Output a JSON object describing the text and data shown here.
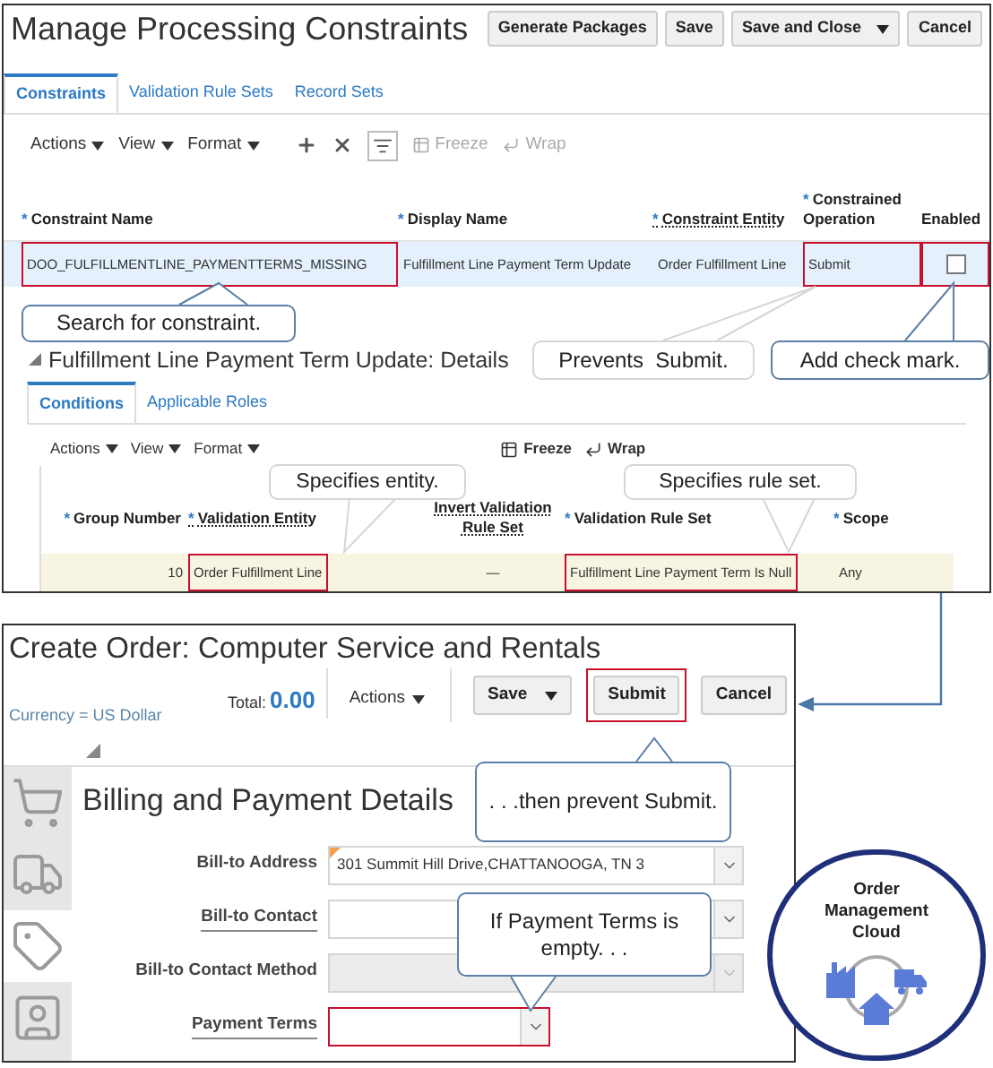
{
  "constraints": {
    "title": "Manage Processing Constraints",
    "buttons": [
      {
        "label": "Generate Packages",
        "kind": "button"
      },
      {
        "label": "Save",
        "kind": "button"
      },
      {
        "label": "Save and Close",
        "kind": "split"
      },
      {
        "label": "Cancel",
        "kind": "button"
      }
    ],
    "tabs": [
      {
        "label": "Constraints",
        "selected": true
      },
      {
        "label": "Validation Rule Sets",
        "selected": false
      },
      {
        "label": "Record Sets",
        "selected": false
      }
    ],
    "toolbar": {
      "menus": [
        "Actions",
        "View",
        "Format"
      ],
      "tools": [
        {
          "label": "Freeze",
          "disabled": true
        },
        {
          "label": "Wrap",
          "disabled": true
        }
      ]
    },
    "table": {
      "columns": [
        {
          "marker": "*",
          "label": "Constraint Name",
          "link": false
        },
        {
          "marker": "*",
          "label": "Display Name",
          "link": false
        },
        {
          "marker": "*",
          "label": "Constraint Entity",
          "link": true
        },
        {
          "marker": "*",
          "label": "Constrained Operation",
          "link": false
        },
        {
          "label": "Enabled",
          "link": false
        }
      ],
      "rows": [
        {
          "cells": [
            {
              "text": "DOO_FULFILLMENTLINE_PAYMENTTERMS_MISSING",
              "highlighted": true
            },
            {
              "text": "Fulfillment Line Payment Term Update",
              "highlighted": false
            },
            {
              "text": "Order Fulfillment Line",
              "highlighted": false
            },
            {
              "text": "Submit",
              "highlighted": true
            }
          ],
          "enabled": false,
          "enabled_highlighted": true
        }
      ]
    }
  },
  "details": {
    "title": "Fulfillment Line Payment Term Update: Details",
    "tabs": [
      {
        "label": "Conditions",
        "selected": true
      },
      {
        "label": "Applicable Roles",
        "selected": false
      }
    ],
    "toolbar": {
      "menus": [
        "Actions",
        "View",
        "Format"
      ],
      "tools": [
        {
          "label": "Freeze",
          "disabled": false
        },
        {
          "label": "Wrap",
          "disabled": false
        }
      ]
    },
    "table": {
      "columns": [
        {
          "marker": "*",
          "label": "Group Number",
          "link": false
        },
        {
          "marker": "*",
          "label": "Validation Entity",
          "link": true
        },
        {
          "label": "Invert Validation Rule Set",
          "link": true
        },
        {
          "marker": "*",
          "label": "Validation Rule Set",
          "link": false
        },
        {
          "marker": "*",
          "label": "Scope",
          "link": false
        }
      ],
      "rows": [
        {
          "cells": [
            {
              "text": "10",
              "highlighted": false
            },
            {
              "text": "Order Fulfillment Line",
              "highlighted": true
            },
            {
              "text": "—",
              "highlighted": false
            },
            {
              "text": "Fulfillment Line Payment Term Is Null",
              "highlighted": true
            },
            {
              "text": "Any",
              "highlighted": false
            }
          ]
        }
      ]
    }
  },
  "order": {
    "title": "Create Order: Computer Service and Rentals",
    "currency": "Currency = US Dollar",
    "total_label": "Total:",
    "total": "0.00",
    "actions": "Actions",
    "buttons": [
      {
        "label": "Save",
        "kind": "split",
        "highlighted": false
      },
      {
        "label": "Submit",
        "kind": "button",
        "highlighted": true
      },
      {
        "label": "Cancel",
        "kind": "button",
        "highlighted": false
      }
    ],
    "rail": [
      {
        "kind": "cart",
        "selected": false
      },
      {
        "kind": "truck",
        "selected": false
      },
      {
        "kind": "tag",
        "selected": true
      },
      {
        "kind": "contact",
        "selected": false
      }
    ],
    "section": "Billing and Payment Details",
    "fields": [
      {
        "label": "Bill-to Address",
        "value": "301 Summit Hill Drive,CHATTANOOGA, TN 3",
        "link": false,
        "disabled": false,
        "changed": true,
        "highlighted": false,
        "kind": "wide"
      },
      {
        "label": "Bill-to Contact",
        "link": true,
        "disabled": false,
        "changed": false,
        "highlighted": false,
        "kind": "wide"
      },
      {
        "label": "Bill-to Contact Method",
        "link": false,
        "disabled": true,
        "changed": false,
        "highlighted": false,
        "kind": "wide"
      },
      {
        "label": "Payment Terms",
        "link": true,
        "disabled": false,
        "changed": false,
        "highlighted": true,
        "kind": "short"
      }
    ]
  },
  "callouts": [
    {
      "text": "Search for constraint.",
      "color": "#5b7fa6"
    },
    {
      "text": "Prevents  Submit.",
      "color": "#d6d6d6"
    },
    {
      "text": "Add check mark.",
      "color": "#5b7fa6"
    },
    {
      "text": "Specifies entity.",
      "color": "#d6d6d6"
    },
    {
      "text": "Specifies rule set.",
      "color": "#d6d6d6"
    },
    {
      "text": ". . .then prevent Submit.",
      "color": "#5b7fa6"
    },
    {
      "text": "If Payment Terms is empty. . .",
      "color": "#5b7fa6"
    }
  ],
  "logo": {
    "lines": [
      "Order",
      "Management",
      "Cloud"
    ]
  }
}
